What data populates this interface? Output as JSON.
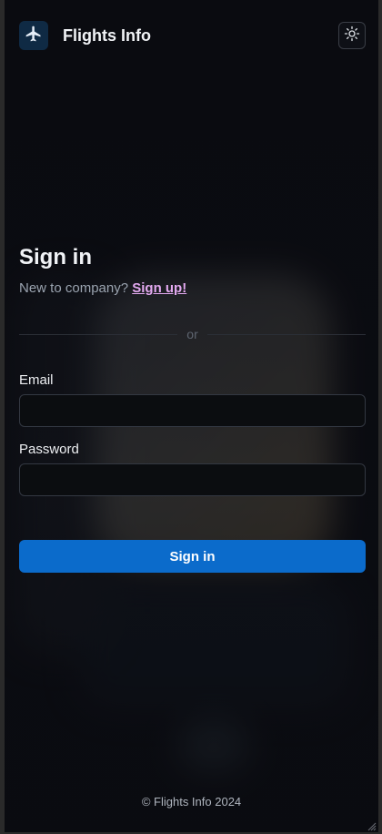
{
  "app": {
    "brand": "Flights Info",
    "logo_icon": "airplane-icon",
    "theme_icon": "sun-icon"
  },
  "signin": {
    "title": "Sign in",
    "new_prompt": "New to company?",
    "signup_link": "Sign up!",
    "divider_text": "or",
    "email_label": "Email",
    "email_value": "",
    "password_label": "Password",
    "password_value": "",
    "submit_label": "Sign in"
  },
  "footer": {
    "text": "© Flights Info 2024"
  },
  "colors": {
    "accent": "#0b6bcb",
    "link": "#e3a9f0",
    "background": "#0b0c12"
  }
}
